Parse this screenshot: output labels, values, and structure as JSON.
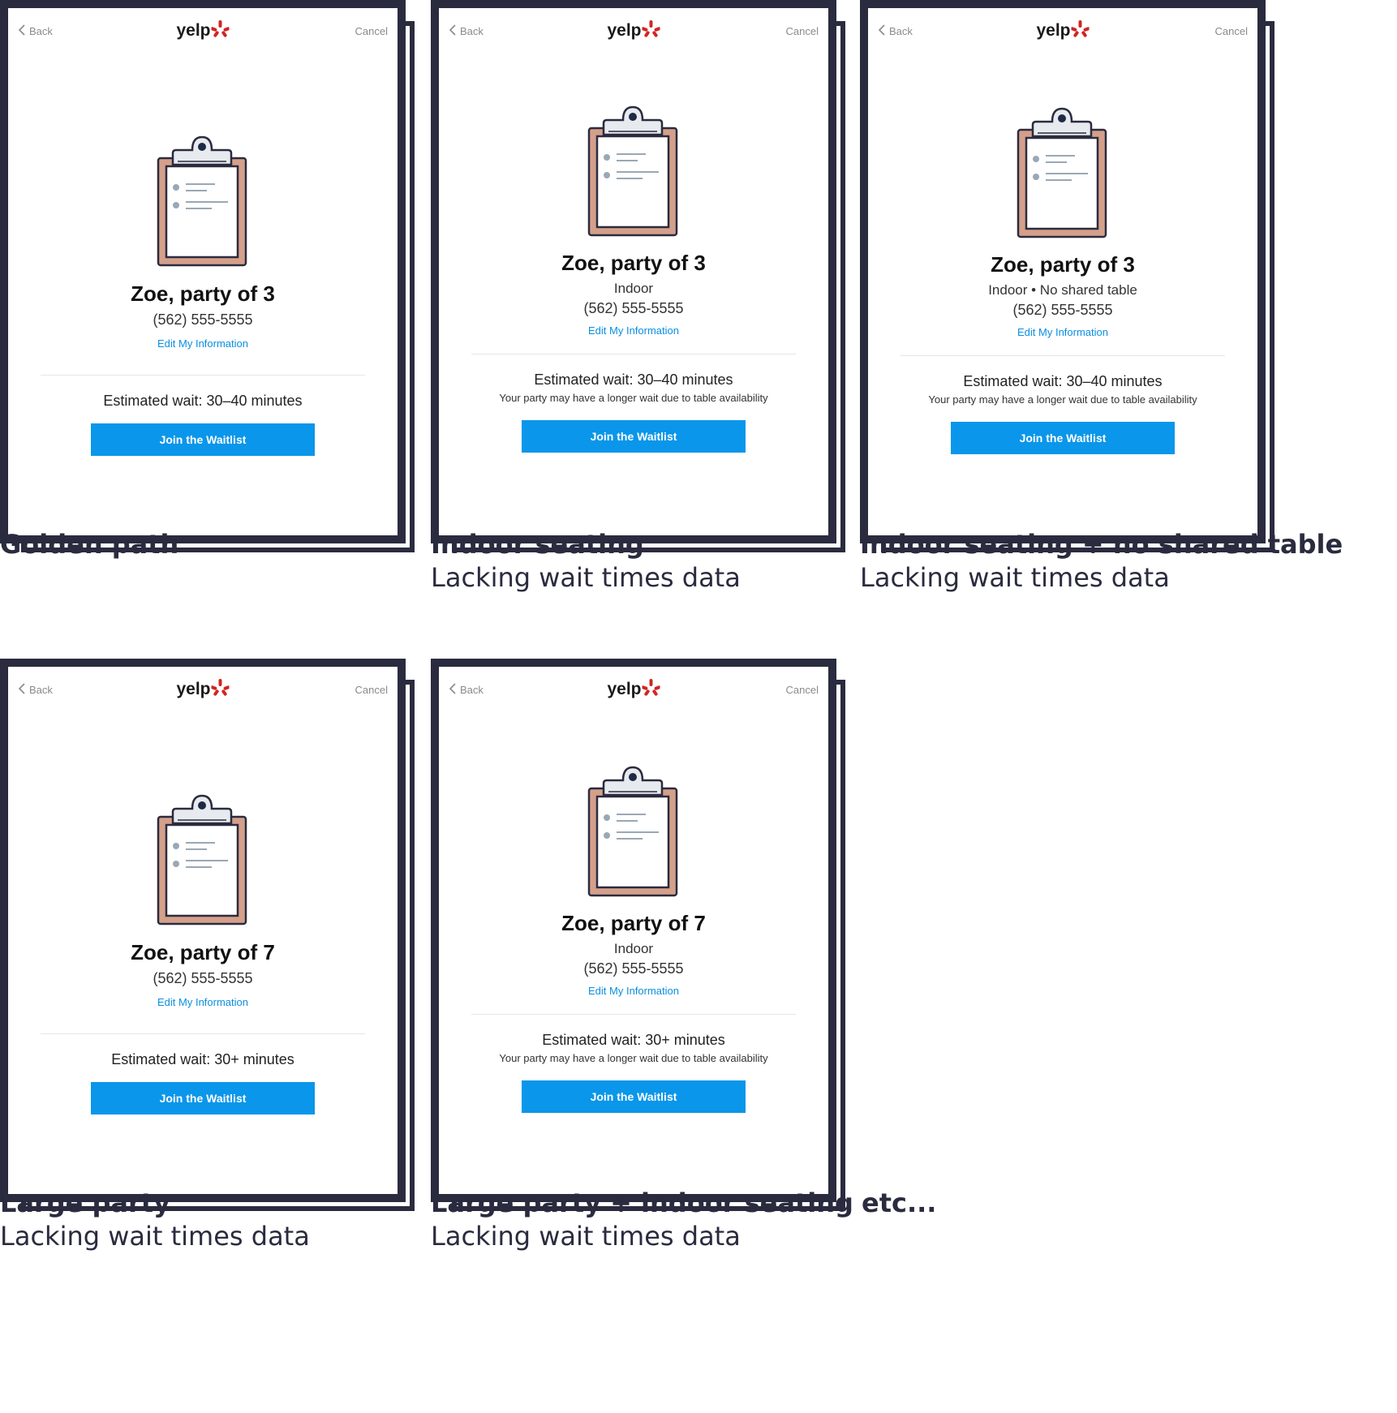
{
  "common": {
    "back_label": "Back",
    "cancel_label": "Cancel",
    "logo_text": "yelp",
    "edit_label": "Edit My Information",
    "join_label": "Join the Waitlist",
    "availability_note": "Your party may have a longer wait due to table availability"
  },
  "variants": [
    {
      "name": "Zoe, party of 3",
      "seating": "",
      "phone": "(562) 555-5555",
      "wait": "Estimated wait: 30–40 minutes",
      "note": "",
      "caption_title": "Golden path",
      "caption_sub": ""
    },
    {
      "name": "Zoe, party of 3",
      "seating": "Indoor",
      "phone": "(562) 555-5555",
      "wait": "Estimated wait: 30–40 minutes",
      "note": "Your party may have a longer wait due to table availability",
      "caption_title": "Indoor seating",
      "caption_sub": "Lacking wait times data"
    },
    {
      "name": "Zoe, party of 3",
      "seating": "Indoor • No shared table",
      "phone": "(562) 555-5555",
      "wait": "Estimated wait: 30–40 minutes",
      "note": "Your party may have a longer wait due to table availability",
      "caption_title": "Indoor seating + no shared table",
      "caption_sub": "Lacking wait times data"
    },
    {
      "name": "Zoe, party of 7",
      "seating": "",
      "phone": "(562) 555-5555",
      "wait": "Estimated wait: 30+ minutes",
      "note": "",
      "caption_title": "Large party",
      "caption_sub": "Lacking wait times data"
    },
    {
      "name": "Zoe, party of 7",
      "seating": "Indoor",
      "phone": "(562) 555-5555",
      "wait": "Estimated wait: 30+ minutes",
      "note": "Your party may have a longer wait due to table availability",
      "caption_title": "Large party + indoor seating",
      "caption_sub": "Lacking wait times data"
    }
  ],
  "etc_label": "etc...",
  "icons": {
    "chevron": "chevron-left-icon",
    "logo_burst": "yelp-burst-icon",
    "clipboard": "clipboard-icon"
  },
  "colors": {
    "frame": "#2b2b3f",
    "button": "#0a96ea",
    "link": "#0a8fe0",
    "clipboard_board": "#d4a08a",
    "yelp_red": "#d32323"
  }
}
